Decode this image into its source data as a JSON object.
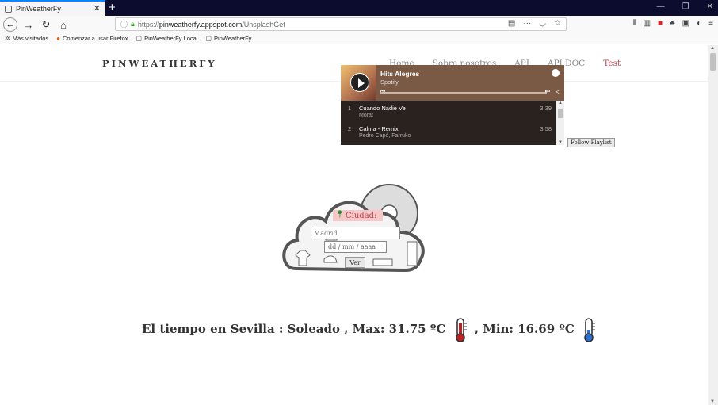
{
  "browser": {
    "tab_title": "PinWeatherFy",
    "url_prefix": "https://",
    "url_host": "pinweatherfy.appspot.com",
    "url_path": "/UnsplashGet"
  },
  "bookmarks": [
    {
      "label": "Más visitados"
    },
    {
      "label": "Comenzar a usar Firefox"
    },
    {
      "label": "PinWeatherFy Local"
    },
    {
      "label": "PinWeatherFy"
    }
  ],
  "site": {
    "brand": "PINWEATHERFY",
    "menu": [
      {
        "label": "Home"
      },
      {
        "label": "Sobre nosotros"
      },
      {
        "label": "API"
      },
      {
        "label": "API DOC"
      },
      {
        "label": "Test"
      }
    ]
  },
  "playlist": {
    "title": "Hits Alegres",
    "source": "Spotify",
    "tracks": [
      {
        "num": "1",
        "name": "Cuando Nadie Ve",
        "artist": "Morat",
        "duration": "3:39"
      },
      {
        "num": "2",
        "name": "Calma - Remix",
        "artist": "Pedro Capó, Farruko",
        "duration": "3:58"
      }
    ],
    "follow_label": "Follow Playlist"
  },
  "form": {
    "city_label": "Ciudad:",
    "city_placeholder": "Madrid",
    "date_placeholder": "dd / mm / aaaa",
    "submit_label": "Ver"
  },
  "weather": {
    "text_main": "El tiempo en Sevilla : Soleado , Max: 31.75 ºC",
    "text_min": ", Min: 16.69 ºC"
  },
  "colors": {
    "accent": "#c0404e",
    "tabbar": "#0c0c2e"
  }
}
